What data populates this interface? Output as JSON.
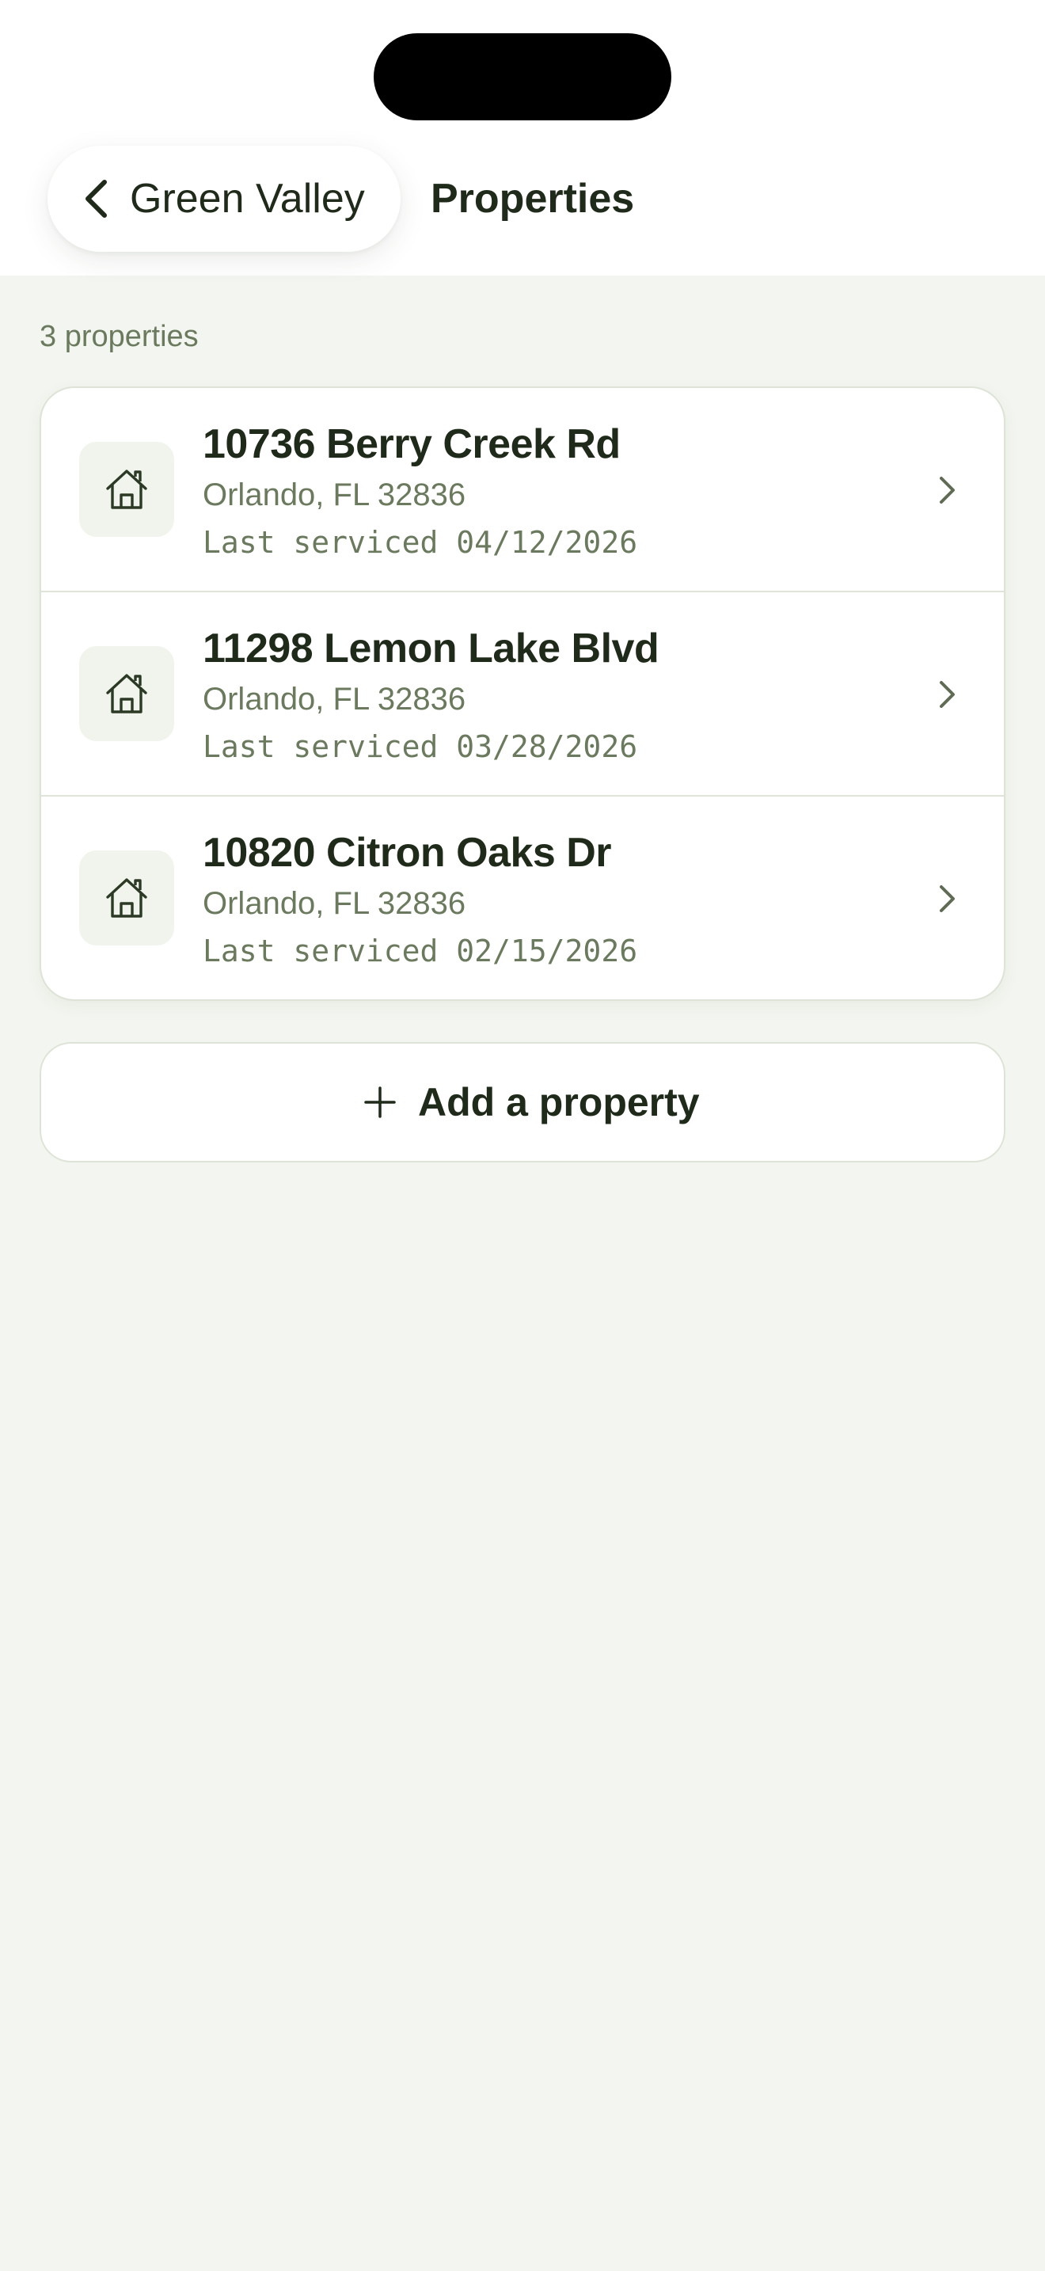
{
  "header": {
    "back_label": "Green Valley",
    "title": "Properties"
  },
  "list": {
    "count_label": "3 properties",
    "items": [
      {
        "address": "10736 Berry Creek Rd",
        "city": "Orlando, FL 32836",
        "serviced": "Last serviced 04/12/2026"
      },
      {
        "address": "11298 Lemon Lake Blvd",
        "city": "Orlando, FL 32836",
        "serviced": "Last serviced 03/28/2026"
      },
      {
        "address": "10820 Citron Oaks Dr",
        "city": "Orlando, FL 32836",
        "serviced": "Last serviced 02/15/2026"
      }
    ]
  },
  "actions": {
    "add_label": "Add a property"
  },
  "icons": {
    "back": "chevron-left-icon",
    "property": "house-icon",
    "row_chevron": "chevron-right-icon",
    "add": "plus-icon"
  },
  "colors": {
    "background": "#f3f6f0",
    "surface": "#ffffff",
    "text_primary": "#1f2a1a",
    "text_secondary": "#6b7a5e",
    "border": "#dde3d6"
  }
}
